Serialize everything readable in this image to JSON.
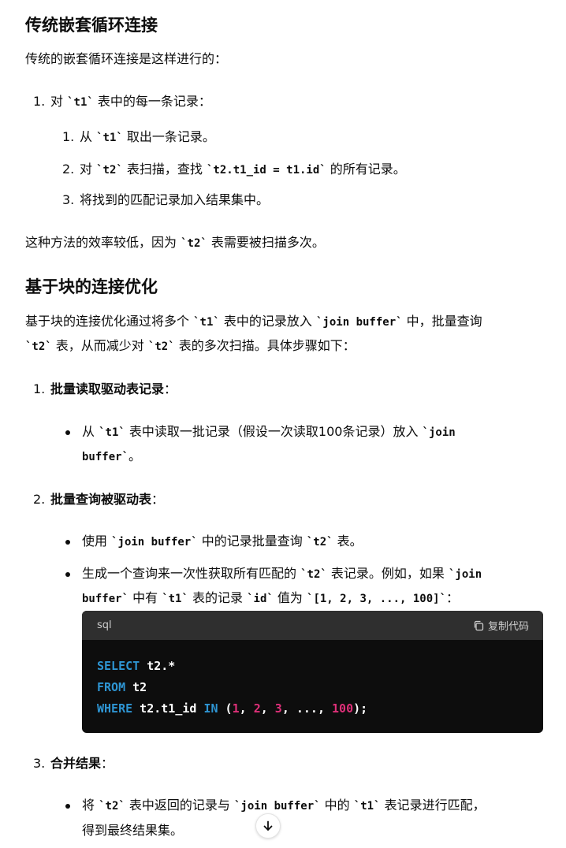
{
  "section1": {
    "title": "传统嵌套循环连接",
    "intro": "传统的嵌套循环连接是这样进行的：",
    "step1": {
      "num": "1.",
      "pre": "对 ",
      "code": "`t1`",
      "post": " 表中的每一条记录："
    },
    "sub1": {
      "num": "1.",
      "pre": "从 ",
      "code": "`t1`",
      "post": " 取出一条记录。"
    },
    "sub2": {
      "num": "2.",
      "pre": "对 ",
      "code": "`t2`",
      "mid": " 表扫描，查找 ",
      "code2": "`t2.t1_id = t1.id`",
      "post": " 的所有记录。"
    },
    "sub3": {
      "num": "3.",
      "text": "将找到的匹配记录加入结果集中。"
    },
    "outro": {
      "pre": "这种方法的效率较低，因为 ",
      "code": "`t2`",
      "post": " 表需要被扫描多次。"
    }
  },
  "section2": {
    "title": "基于块的连接优化",
    "intro_l1": {
      "pre": "基于块的连接优化通过将多个 ",
      "code": "`t1`",
      "mid": " 表中的记录放入 ",
      "code2": "`join buffer`",
      "post": " 中，批量查询"
    },
    "intro_l2": {
      "code": "`t2`",
      "mid": " 表，从而减少对 ",
      "code2": "`t2`",
      "post": " 表的多次扫描。具体步骤如下："
    },
    "step1": {
      "num": "1.",
      "bold": "批量读取驱动表记录",
      "post": "："
    },
    "step1_b1_l1": {
      "pre": "从 ",
      "code": "`t1`",
      "post": " 表中读取一批记录（假设一次读取100条记录）放入 ",
      "code2": "`join"
    },
    "step1_b1_l2": {
      "code": "buffer`",
      "post": "。"
    },
    "step2": {
      "num": "2.",
      "bold": "批量查询被驱动表",
      "post": "："
    },
    "step2_b1": {
      "pre": "使用 ",
      "code": "`join buffer`",
      "mid": " 中的记录批量查询 ",
      "code2": "`t2`",
      "post": " 表。"
    },
    "step2_b2_l1": {
      "pre": "生成一个查询来一次性获取所有匹配的 ",
      "code": "`t2`",
      "post": " 表记录。例如，如果 ",
      "code2": "`join"
    },
    "step2_b2_l2": {
      "code": "buffer`",
      "mid": " 中有 ",
      "code2": "`t1`",
      "mid2": " 表的记录 ",
      "code3": "`id`",
      "mid3": " 值为 ",
      "code4": "`[1, 2, 3, ..., 100]`",
      "post": "："
    },
    "codeblock": {
      "lang": "sql",
      "copy_label": "复制代码",
      "l1_kw": "SELECT",
      "l1_rest": " t2.*",
      "l2_kw": "FROM",
      "l2_rest": " t2",
      "l3_kw": "WHERE",
      "l3_a": " t2.t1_id ",
      "l3_kw2": "IN",
      "l3_b": " (",
      "n1": "1",
      "sep1": ", ",
      "n2": "2",
      "sep2": ", ",
      "n3": "3",
      "sep3": ", ..., ",
      "n4": "100",
      "l3_end": ");"
    },
    "step3": {
      "num": "3.",
      "bold": "合并结果",
      "post": "："
    },
    "step3_b1_l1": {
      "pre": "将 ",
      "code": "`t2`",
      "mid": " 表中返回的记录与 ",
      "code2": "`join buffer`",
      "mid2": " 中的 ",
      "code3": "`t1`",
      "post": " 表记录进行匹配，"
    },
    "step3_b1_l2": "得到最终结果集。"
  },
  "scroll_down_icon": "arrow-down-icon"
}
